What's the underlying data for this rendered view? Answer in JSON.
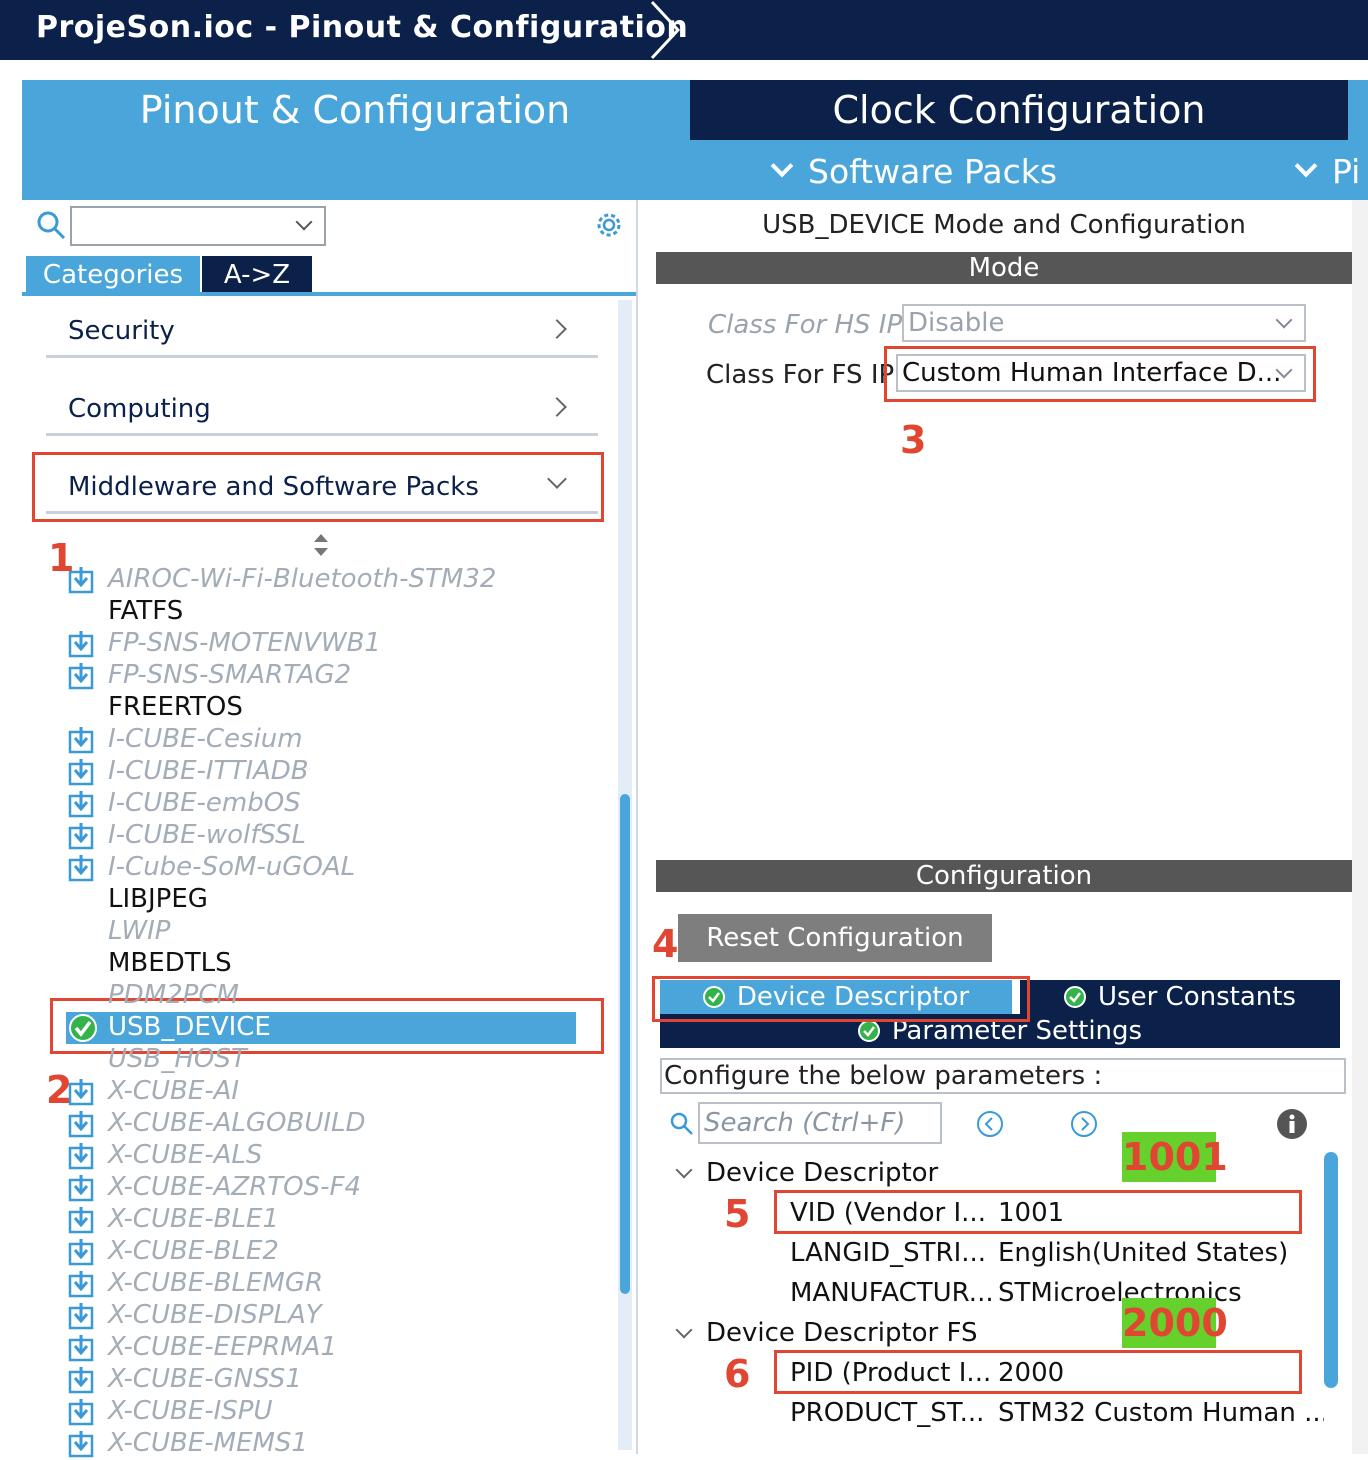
{
  "window": {
    "title": "ProjeSon.ioc - Pinout & Configuration"
  },
  "tabs": {
    "pinout": "Pinout & Configuration",
    "clock": "Clock Configuration",
    "software_packs": "Software Packs",
    "pinout_sub": "Pi"
  },
  "left": {
    "search_value": "",
    "tab_categories": "Categories",
    "tab_az": "A->Z",
    "categories": [
      {
        "label": "Security"
      },
      {
        "label": "Computing"
      },
      {
        "label": "Middleware and Software Packs"
      }
    ],
    "items": [
      {
        "label": "AIROC-Wi-Fi-Bluetooth-STM32",
        "style": "grey",
        "icon": "download-icon"
      },
      {
        "label": "FATFS",
        "style": "dark",
        "icon": ""
      },
      {
        "label": "FP-SNS-MOTENVWB1",
        "style": "grey",
        "icon": "download-icon"
      },
      {
        "label": "FP-SNS-SMARTAG2",
        "style": "grey",
        "icon": "download-icon"
      },
      {
        "label": "FREERTOS",
        "style": "dark",
        "icon": ""
      },
      {
        "label": "I-CUBE-Cesium",
        "style": "grey",
        "icon": "download-icon"
      },
      {
        "label": "I-CUBE-ITTIADB",
        "style": "grey",
        "icon": "download-icon"
      },
      {
        "label": "I-CUBE-embOS",
        "style": "grey",
        "icon": "download-icon"
      },
      {
        "label": "I-CUBE-wolfSSL",
        "style": "grey",
        "icon": "download-icon"
      },
      {
        "label": "I-Cube-SoM-uGOAL",
        "style": "grey",
        "icon": "download-icon"
      },
      {
        "label": "LIBJPEG",
        "style": "dark",
        "icon": ""
      },
      {
        "label": "LWIP",
        "style": "grey",
        "icon": ""
      },
      {
        "label": "MBEDTLS",
        "style": "dark",
        "icon": ""
      },
      {
        "label": "PDM2PCM",
        "style": "grey",
        "icon": ""
      },
      {
        "label": "USB_DEVICE",
        "style": "selected",
        "icon": "check-icon"
      },
      {
        "label": "USB_HOST",
        "style": "grey",
        "icon": ""
      },
      {
        "label": "X-CUBE-AI",
        "style": "grey",
        "icon": "download-icon"
      },
      {
        "label": "X-CUBE-ALGOBUILD",
        "style": "grey",
        "icon": "download-icon"
      },
      {
        "label": "X-CUBE-ALS",
        "style": "grey",
        "icon": "download-icon"
      },
      {
        "label": "X-CUBE-AZRTOS-F4",
        "style": "grey",
        "icon": "download-icon"
      },
      {
        "label": "X-CUBE-BLE1",
        "style": "grey",
        "icon": "download-icon"
      },
      {
        "label": "X-CUBE-BLE2",
        "style": "grey",
        "icon": "download-icon"
      },
      {
        "label": "X-CUBE-BLEMGR",
        "style": "grey",
        "icon": "download-icon"
      },
      {
        "label": "X-CUBE-DISPLAY",
        "style": "grey",
        "icon": "download-icon"
      },
      {
        "label": "X-CUBE-EEPRMA1",
        "style": "grey",
        "icon": "download-icon"
      },
      {
        "label": "X-CUBE-GNSS1",
        "style": "grey",
        "icon": "download-icon"
      },
      {
        "label": "X-CUBE-ISPU",
        "style": "grey",
        "icon": "download-icon"
      },
      {
        "label": "X-CUBE-MEMS1",
        "style": "grey",
        "icon": "download-icon"
      }
    ]
  },
  "annotations": {
    "n1": "1",
    "n2": "2",
    "n3": "3",
    "n4": "4",
    "n5": "5",
    "n6": "6"
  },
  "right": {
    "mode_title": "USB_DEVICE Mode and Configuration",
    "mode_bar": "Mode",
    "hs_label": "Class For HS IP",
    "hs_value": "Disable",
    "fs_label": "Class For FS IP",
    "fs_value": "Custom Human Interface D...",
    "config_bar": "Configuration",
    "reset_button": "Reset Configuration",
    "tab_device_descriptor": "Device Descriptor",
    "tab_user_constants": "User Constants",
    "tab_parameter_settings": "Parameter Settings",
    "hint": "Configure the below parameters :",
    "search_placeholder": "Search (Ctrl+F)",
    "groups": {
      "dd": "Device Descriptor",
      "ddfs": "Device Descriptor FS"
    },
    "params": {
      "vid_name": "VID (Vendor I...",
      "vid_value": "1001",
      "langid_name": "LANGID_STRI...",
      "langid_value": "English(United States)",
      "manuf_name": "MANUFACTUR...",
      "manuf_value": "STMicroelectronics",
      "pid_name": "PID (Product I...",
      "pid_value": "2000",
      "product_name": "PRODUCT_ST...",
      "product_value": "STM32 Custom Human ..."
    },
    "badges": {
      "vid": "1001",
      "pid": "2000"
    }
  },
  "colors": {
    "navy": "#0b2149",
    "accent": "#4aa6da",
    "annotation_red": "#e04632",
    "badge_green": "#66d02c"
  }
}
